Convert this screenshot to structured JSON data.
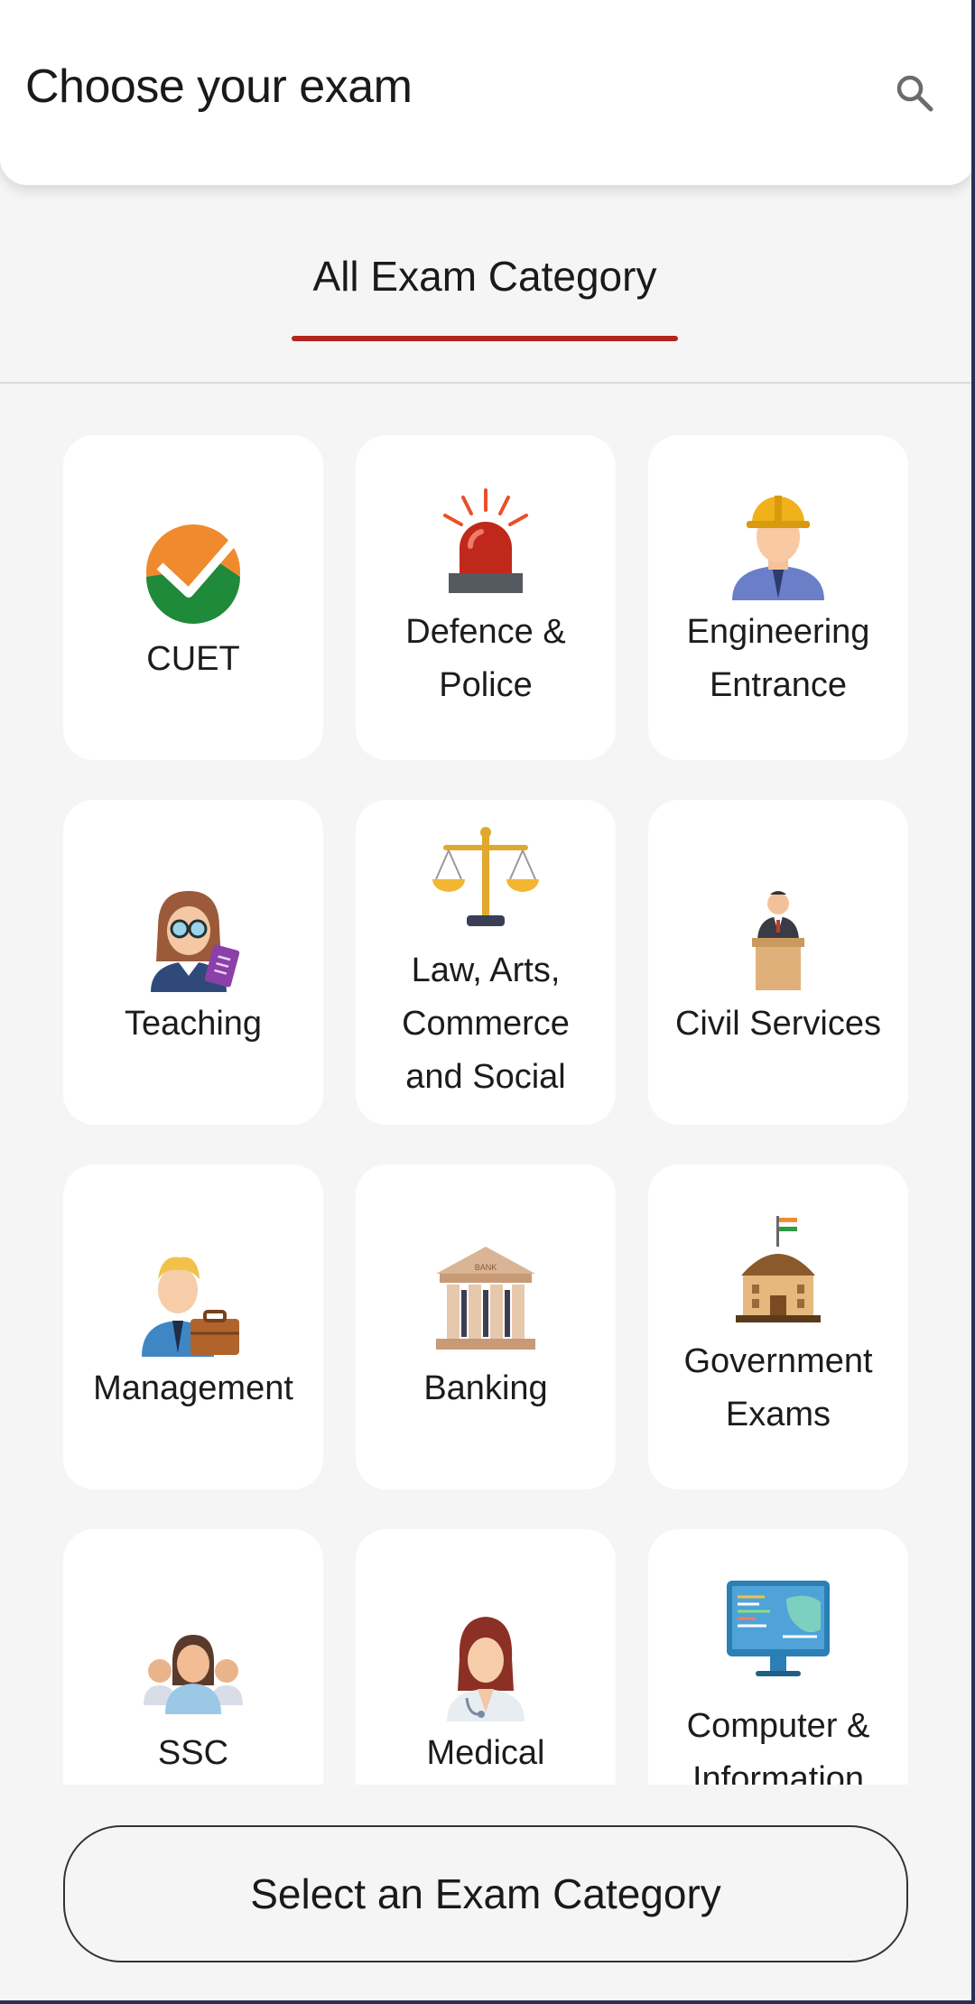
{
  "header": {
    "title": "Choose your exam"
  },
  "tabs": [
    {
      "label": "All Exam Category",
      "active": true
    }
  ],
  "categories": [
    {
      "label": "CUET",
      "icon": "cuet-check-icon"
    },
    {
      "label": "Defence &\nPolice",
      "icon": "siren-icon"
    },
    {
      "label": "Engineering\nEntrance",
      "icon": "engineer-icon"
    },
    {
      "label": "Teaching",
      "icon": "teacher-icon"
    },
    {
      "label": "Law, Arts,\nCommerce\nand Social",
      "icon": "scales-icon"
    },
    {
      "label": "Civil Services",
      "icon": "podium-speaker-icon"
    },
    {
      "label": "Management",
      "icon": "manager-briefcase-icon"
    },
    {
      "label": "Banking",
      "icon": "bank-building-icon"
    },
    {
      "label": "Government\nExams",
      "icon": "government-building-icon"
    },
    {
      "label": "SSC",
      "icon": "group-people-icon"
    },
    {
      "label": "Medical",
      "icon": "doctor-icon"
    },
    {
      "label": "Computer &\nInformation",
      "icon": "computer-monitor-icon"
    }
  ],
  "bottom": {
    "button_label": "Select an Exam Category"
  },
  "colors": {
    "accent": "#b3261e",
    "background": "#f5f5f5",
    "card": "#ffffff"
  }
}
